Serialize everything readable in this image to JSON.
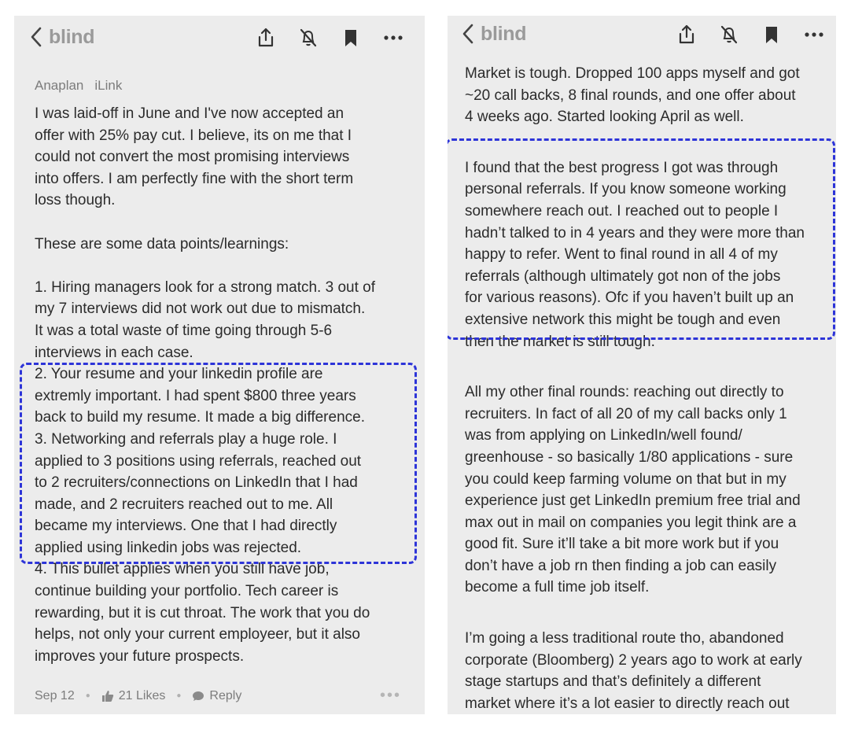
{
  "app": {
    "brand": "blind"
  },
  "left_post": {
    "tags": [
      "Anaplan",
      "iLink"
    ],
    "paragraphs": [
      "I was laid-off in June and I've now accepted an\noffer with 25% pay cut.  I believe, its on me that I\ncould not convert the most promising interviews\ninto offers. I am perfectly fine with the short term\nloss though.",
      "These are some data points/learnings:",
      "1. Hiring managers look for a strong match. 3 out of\nmy 7 interviews did not work out due to mismatch.\nIt was a total waste of time going through 5-6\ninterviews in each case.\n2. Your resume and your linkedin profile are\nextremly important. I had spent $800 three years\nback to build my resume. It made a big  difference.\n3. Networking and referrals play a huge role. I\napplied to 3 positions using referrals, reached out\nto 2 recruiters/connections on LinkedIn that I had\nmade, and 2 recruiters reached out to me. All\nbecame my interviews. One that I had directly\napplied using linkedin jobs was rejected.\n4. This bullet applies when you still have job,\ncontinue building your portfolio. Tech career is\nrewarding, but it is cut throat. The work that you do\nhelps, not only your current employeer, but it also\nimproves your future prospects."
    ],
    "footer": {
      "date": "Sep 12",
      "likes": "21 Likes",
      "reply": "Reply"
    }
  },
  "right_post": {
    "paragraphs": [
      "Market is tough. Dropped 100 apps myself and got\n~20 call backs, 8 final rounds, and one offer about\n4 weeks ago. Started looking April as well.",
      "I found that the best progress I got was through\npersonal referrals. If you know someone working\nsomewhere reach out. I reached out to people I\nhadn’t talked to in 4 years and they were more than\nhappy to refer. Went to final round in all 4 of my\nreferrals (although ultimately got non of the jobs\nfor various reasons). Ofc if you haven’t built up an\nextensive network this might be tough and even\nthen the market is still tough.",
      "All my other final rounds: reaching out directly to\nrecruiters. In fact of all 20 of my call backs only 1\nwas from applying on LinkedIn/well found/\ngreenhouse - so basically 1/80 applications - sure\nyou could keep farming volume on that but in my\nexperience just get LinkedIn premium free trial and\nmax out in mail on companies you legit think are a\ngood fit. Sure it’ll take a bit more work but if you\ndon’t have a job rn then finding a job can easily\nbecome a full time job itself.",
      "I’m going a less traditional route tho, abandoned\ncorporate (Bloomberg) 2 years ago to work at early\nstage startups and that’s definitely a different\nmarket where it’s a lot easier to directly reach out\nto ceos/ctos that are hiring but if your open to it I’d\nrecommend it if you live in sf/nyc/seattle. Lots of"
    ]
  },
  "colors": {
    "panel_bg": "#ececec",
    "highlight": "#2d34d8",
    "brand_gray": "#9a9a9a",
    "text": "#2b2b2b"
  },
  "icons": [
    "chevron-left",
    "share",
    "bell-off",
    "bookmark",
    "more-horizontal",
    "thumbs-up",
    "comment"
  ]
}
